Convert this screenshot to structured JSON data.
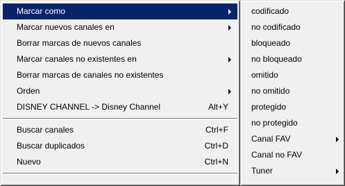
{
  "main_menu": {
    "items": [
      {
        "label": "Marcar como",
        "shortcut": "",
        "submenu": true,
        "selected": true
      },
      {
        "label": "Marcar nuevos canales en",
        "shortcut": "",
        "submenu": true
      },
      {
        "label": "Borrar marcas de nuevos canales",
        "shortcut": ""
      },
      {
        "label": "Marcar canales no existentes en",
        "shortcut": "",
        "submenu": true
      },
      {
        "label": "Borrar marcas de canales no existentes",
        "shortcut": ""
      },
      {
        "label": "Orden",
        "shortcut": "",
        "submenu": true
      },
      {
        "label": "DISNEY CHANNEL -> Disney Channel",
        "shortcut": "Alt+Y"
      },
      {
        "label": "Buscar canales",
        "shortcut": "Ctrl+F"
      },
      {
        "label": "Buscar duplicados",
        "shortcut": "Ctrl+D"
      },
      {
        "label": "Nuevo",
        "shortcut": "Ctrl+N"
      }
    ]
  },
  "sub_menu": {
    "items": [
      {
        "label": "codificado"
      },
      {
        "label": "no codificado"
      },
      {
        "label": "bloqueado"
      },
      {
        "label": "no bloqueado"
      },
      {
        "label": "omitido"
      },
      {
        "label": "no omitido"
      },
      {
        "label": "protegido"
      },
      {
        "label": "no protegido"
      },
      {
        "label": "Canal FAV",
        "submenu": true
      },
      {
        "label": "Canal no FAV"
      },
      {
        "label": "Tuner",
        "submenu": true
      }
    ]
  }
}
